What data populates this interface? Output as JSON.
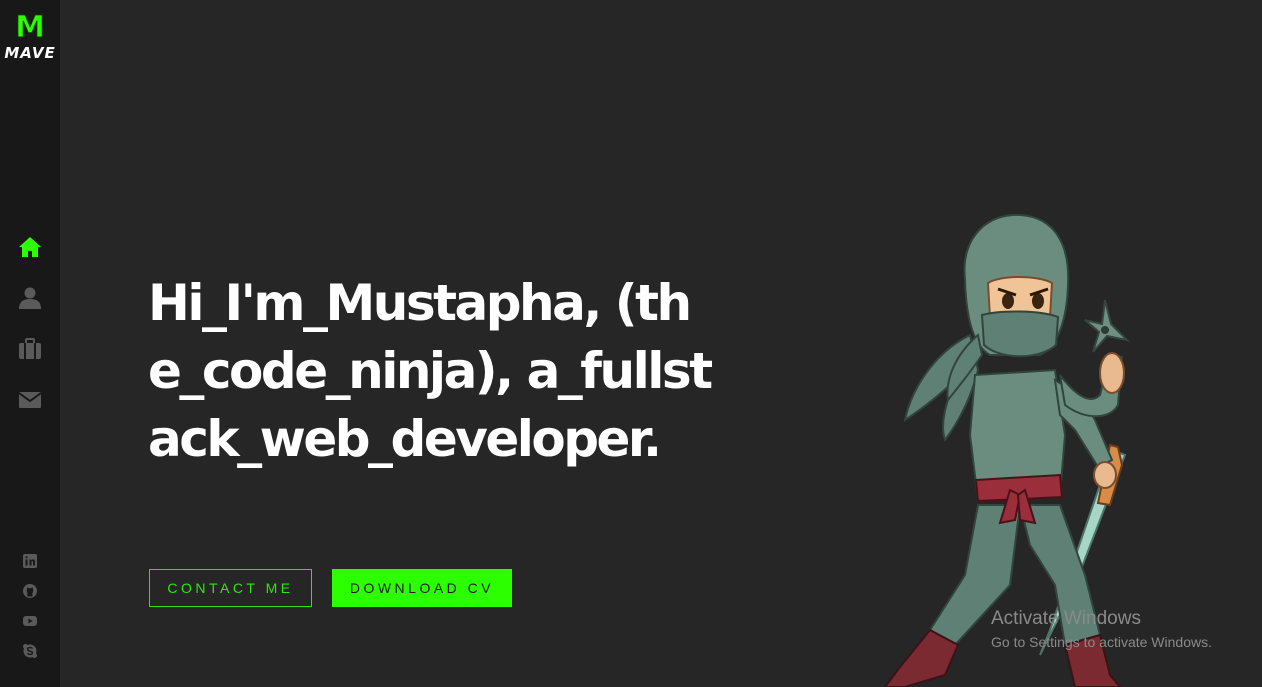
{
  "brand": {
    "logo_letter": "M",
    "name": "MAVE",
    "accent": "#2bff00"
  },
  "sidebar": {
    "nav": [
      {
        "icon": "home-icon",
        "active": true
      },
      {
        "icon": "user-icon",
        "active": false
      },
      {
        "icon": "briefcase-icon",
        "active": false
      },
      {
        "icon": "envelope-icon",
        "active": false
      }
    ],
    "social": [
      {
        "icon": "linkedin-icon"
      },
      {
        "icon": "github-icon"
      },
      {
        "icon": "youtube-icon"
      },
      {
        "icon": "skype-icon"
      }
    ]
  },
  "hero": {
    "headline": "Hi_I'm_Mustapha, (the_code_ninja), a_fullstack_web_developer."
  },
  "buttons": {
    "contact_label": "CONTACT ME",
    "download_label": "DOWNLOAD CV"
  },
  "watermark": {
    "title": "Activate Windows",
    "subtitle": "Go to Settings to activate Windows."
  }
}
